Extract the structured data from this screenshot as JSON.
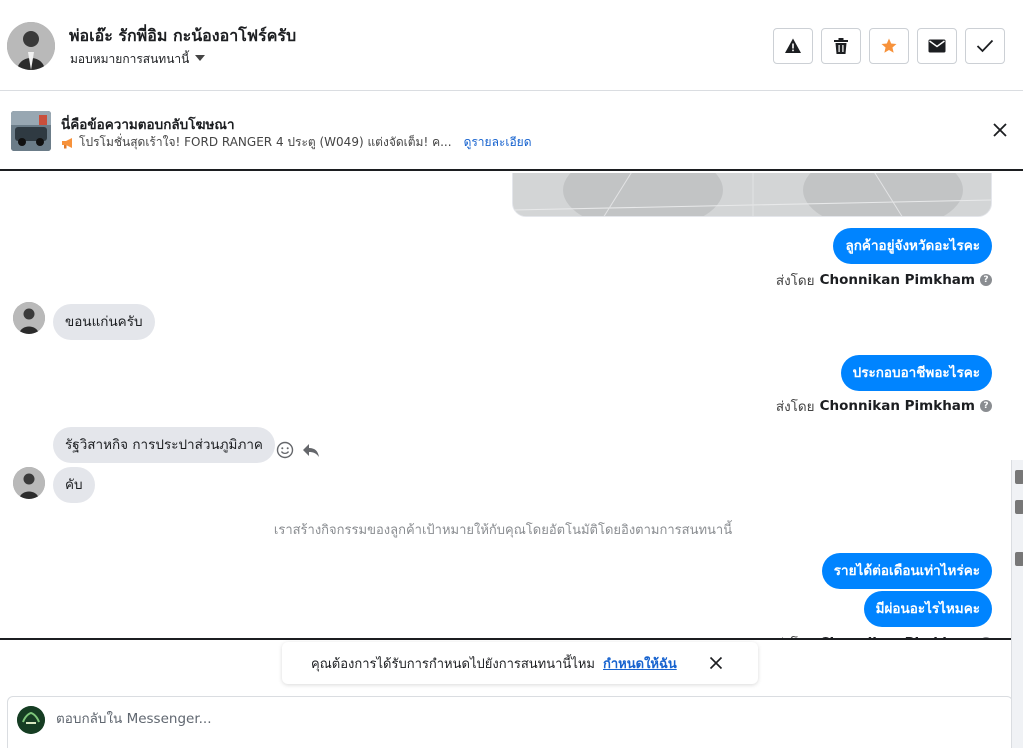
{
  "header": {
    "contact_name": "พ่อเอ๊ะ รักพี่อิม กะน้องอาโฟร์ครับ",
    "assign_label": "มอบหมายการสนทนานี้",
    "actions": [
      {
        "icon": "warning-icon"
      },
      {
        "icon": "trash-icon"
      },
      {
        "icon": "star-icon",
        "color": "#f7923b"
      },
      {
        "icon": "envelope-icon"
      },
      {
        "icon": "check-icon"
      }
    ]
  },
  "ad_banner": {
    "title": "นี่คือข้อความตอบกลับโฆษณา",
    "ad_text": "โปรโมชั่นสุดเร้าใจ! FORD RANGER 4 ประตู (W049) แต่งจัดเต็ม! ค...",
    "details_link": "ดูรายละเอียด",
    "icon": "megaphone-icon"
  },
  "messages": {
    "out_1": "ลูกค้าอยู่จังหวัดอะไรคะ",
    "sent_by_prefix": "ส่งโดย",
    "sender_name": "Chonnikan Pimkham",
    "in_1": "ขอนแก่นครับ",
    "out_2": "ประกอบอาชีพอะไรคะ",
    "in_2": "รัฐวิสาหกิจ การประปาส่วนภูมิภาค",
    "in_3": "คับ",
    "system_note": "เราสร้างกิจกรรมของลูกค้าเป้าหมายให้กับคุณโดยอัตโนมัติโดยอิงตามการสนทนานี้",
    "out_3": "รายได้ต่อเดือนเท่าไหร่คะ",
    "out_4": "มีผ่อนอะไรไหมคะ"
  },
  "reminder": {
    "text": "คุณต้องการได้รับการกำหนดไปยังการสนทนานี้ไหม",
    "link": "กำหนดให้ฉัน"
  },
  "composer": {
    "placeholder": "ตอบกลับใน Messenger..."
  },
  "colors": {
    "outgoing_bubble": "#0084ff",
    "incoming_bubble": "#e4e6eb",
    "link": "#1763cf",
    "star": "#f7923b"
  }
}
